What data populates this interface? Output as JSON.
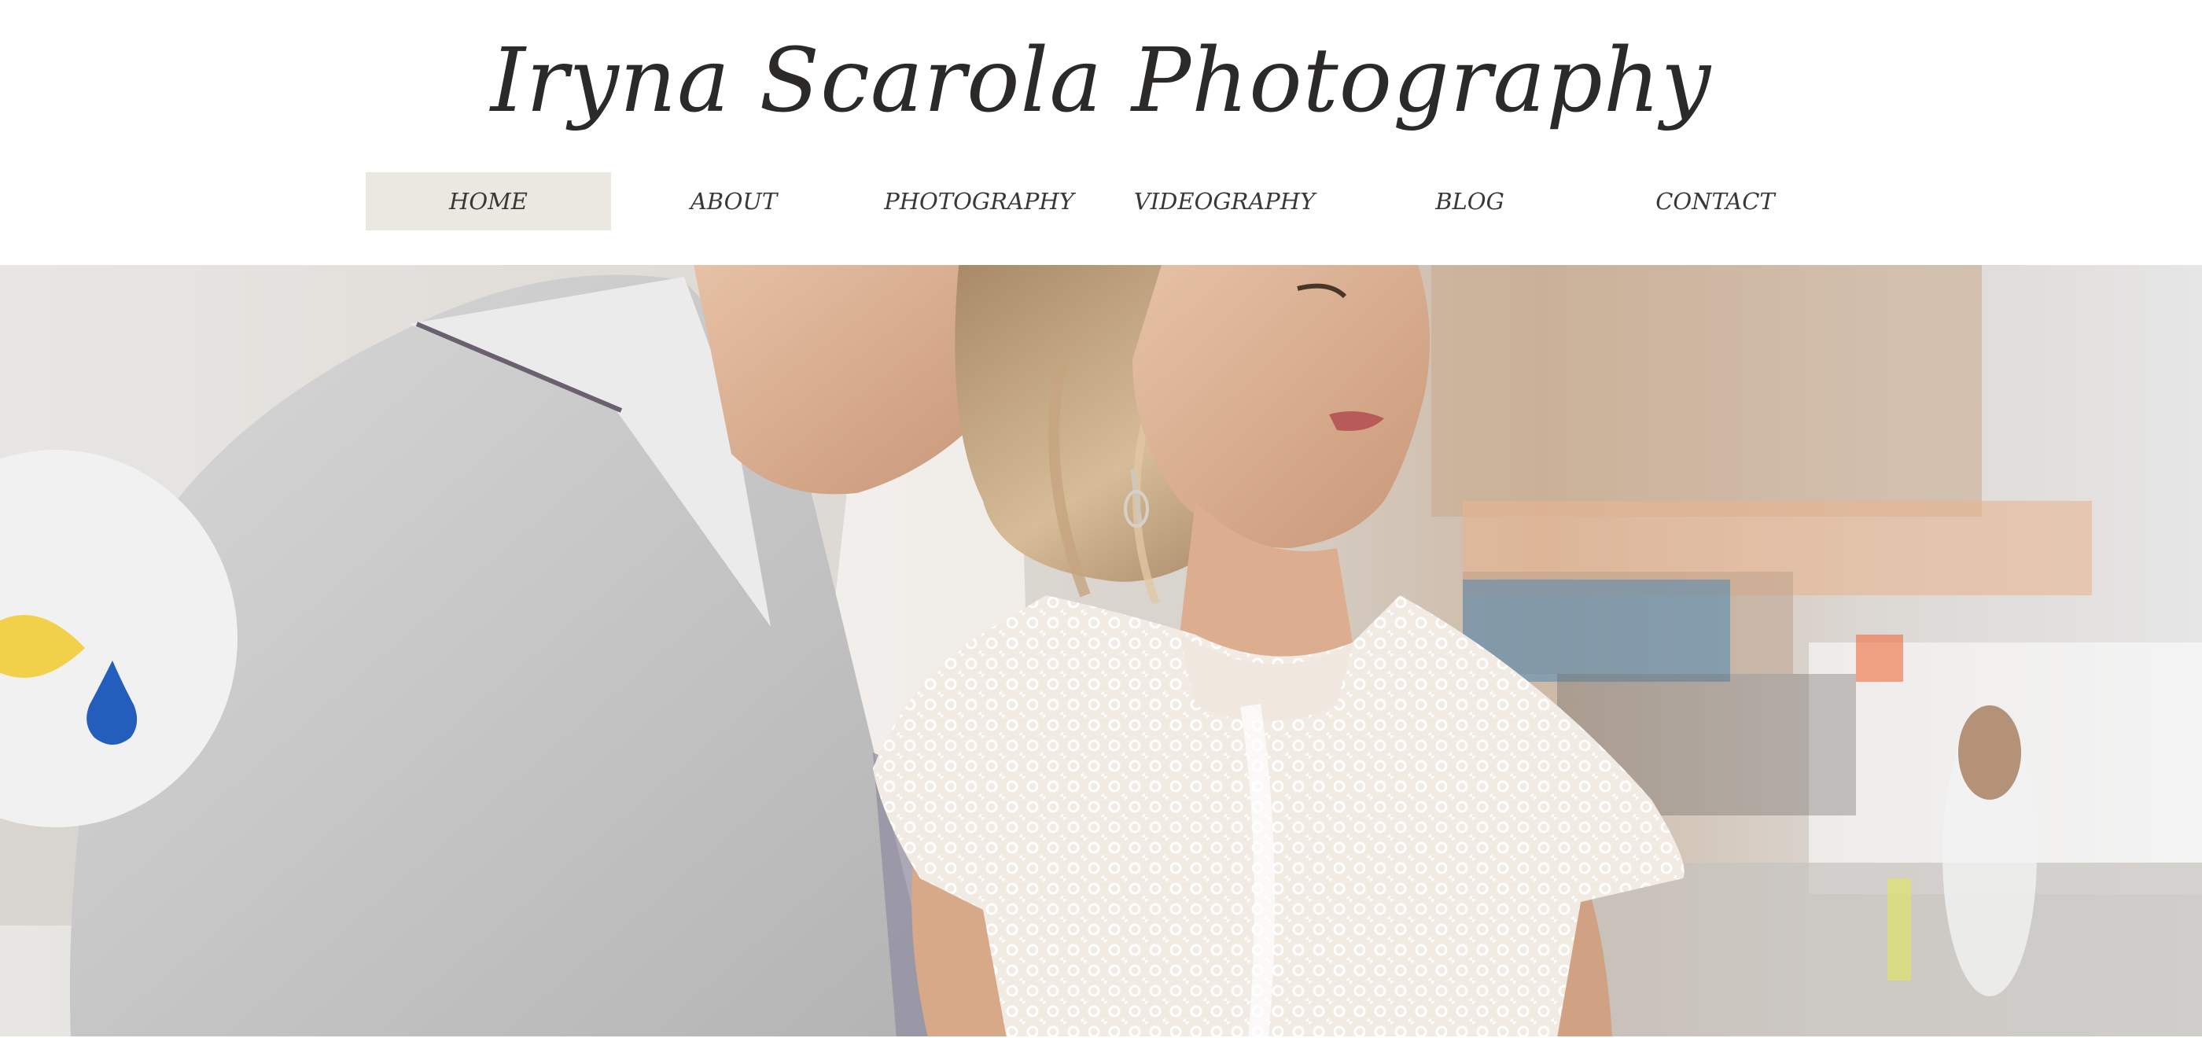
{
  "site": {
    "title": "Iryna Scarola Photography"
  },
  "nav": {
    "items": [
      {
        "label": "HOME",
        "active": true
      },
      {
        "label": "ABOUT",
        "active": false
      },
      {
        "label": "PHOTOGRAPHY",
        "active": false
      },
      {
        "label": "VIDEOGRAPHY",
        "active": false
      },
      {
        "label": "BLOG",
        "active": false
      },
      {
        "label": "CONTACT",
        "active": false
      }
    ]
  },
  "badge": {
    "icon": "yellow-leaf-blue-drop-icon",
    "colors": {
      "leaf": "#f2d14a",
      "drop": "#245ebc",
      "background": "#f1f1f1"
    }
  },
  "hero": {
    "image": "wedding-couple-photo"
  },
  "colors": {
    "text": "#2c2a28",
    "nav_active_bg": "#ebe8e2"
  }
}
